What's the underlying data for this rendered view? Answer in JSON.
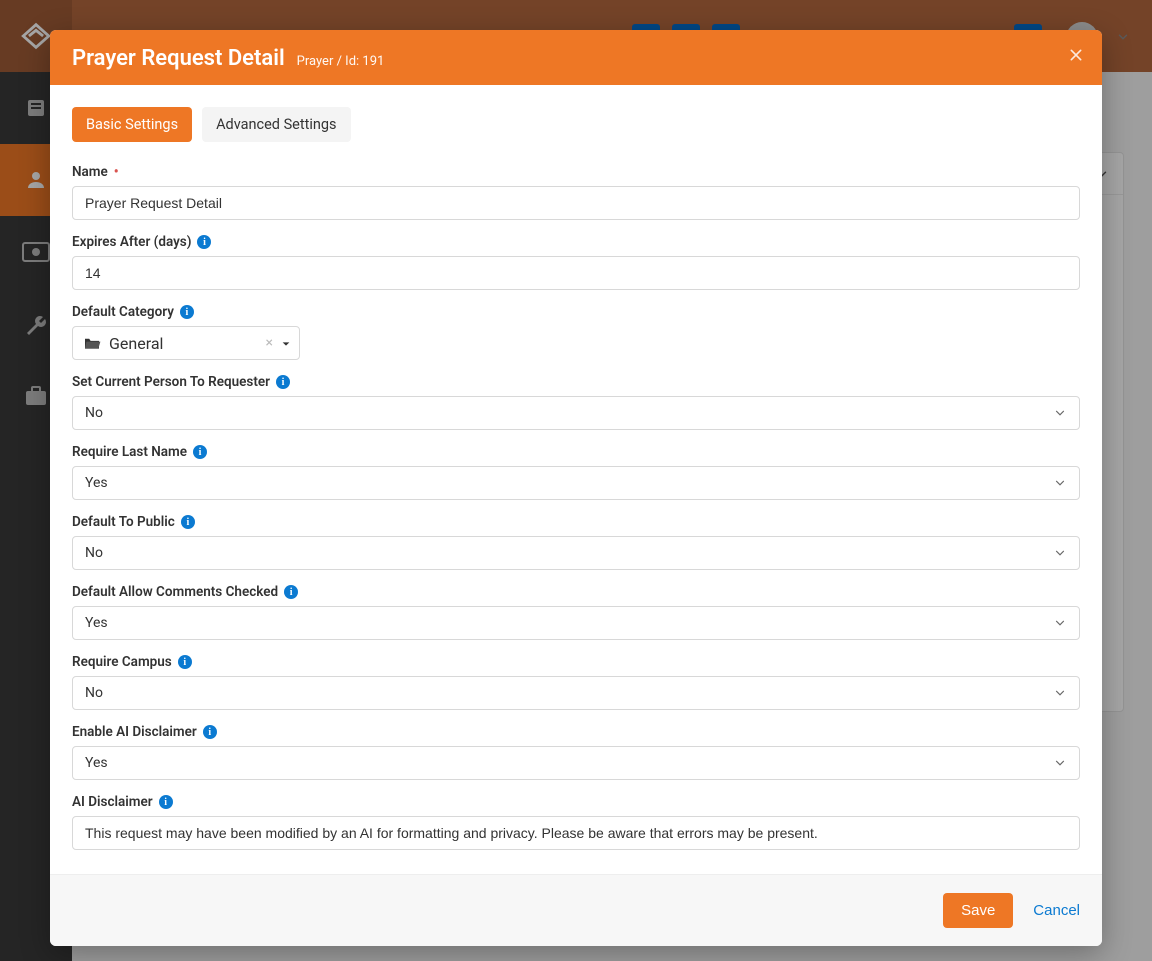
{
  "header": {
    "icon_squares": 3
  },
  "modal": {
    "title": "Prayer Request Detail",
    "subtitle": "Prayer / Id: 191",
    "tabs": {
      "basic": "Basic Settings",
      "advanced": "Advanced Settings"
    },
    "labels": {
      "name": "Name",
      "expires": "Expires After (days)",
      "default_category": "Default Category",
      "set_current_person": "Set Current Person To Requester",
      "require_last_name": "Require Last Name",
      "default_to_public": "Default To Public",
      "default_allow_comments": "Default Allow Comments Checked",
      "require_campus": "Require Campus",
      "enable_ai": "Enable AI Disclaimer",
      "ai_disclaimer": "AI Disclaimer"
    },
    "values": {
      "name": "Prayer Request Detail",
      "expires": "14",
      "default_category": "General",
      "set_current_person": "No",
      "require_last_name": "Yes",
      "default_to_public": "No",
      "default_allow_comments": "Yes",
      "require_campus": "No",
      "enable_ai": "Yes",
      "ai_disclaimer": "This request may have been modified by an AI for formatting and privacy. Please be aware that errors may be present."
    },
    "footer": {
      "save": "Save",
      "cancel": "Cancel"
    }
  }
}
